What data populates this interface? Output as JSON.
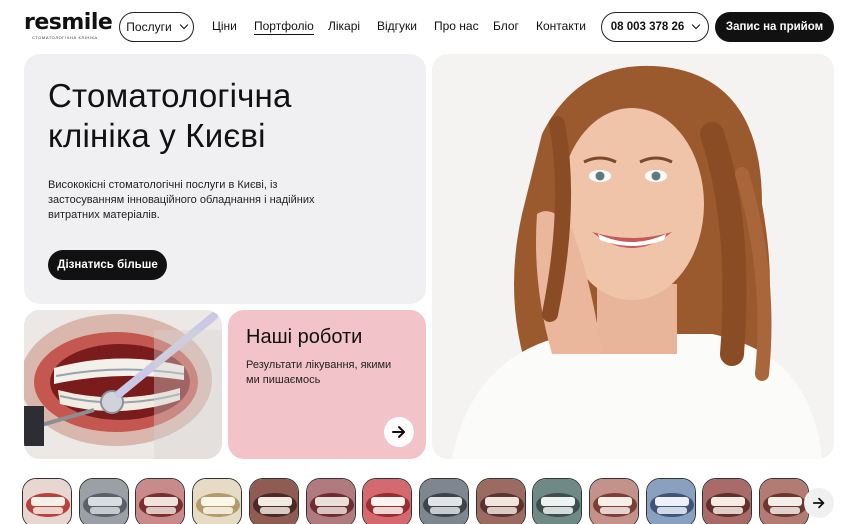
{
  "brand": {
    "logo_text": "resmile",
    "logo_sub": "стоматологічна клініка"
  },
  "nav": {
    "services_label": "Послуги",
    "links": [
      "Ціни",
      "Портфоліо",
      "Лікарі",
      "Відгуки",
      "Про нас",
      "Блог",
      "Контакти"
    ],
    "active_link": "Портфоліо",
    "phone": "08 003 378 26",
    "cta_label": "Запис на прийом"
  },
  "hero": {
    "title_line1": "Стоматологічна",
    "title_line2": "клініка у Києві",
    "description": "Висококісні стоматологічні послуги в Києві, із застосуванням інноваційного обладнання і надійних витратних матеріалів.",
    "button_label": "Дізнатись більше"
  },
  "works": {
    "title": "Наші роботи",
    "description": "Результати лікування, якими ми пишаємось"
  },
  "thumbnails": {
    "count": 14
  },
  "colors": {
    "dark": "#111111",
    "hero_bg": "#f0f0f2",
    "works_bg": "#f2c4c9"
  },
  "icons": {
    "arrow": "arrow-right-icon",
    "dropdown": "chevron-down-icon"
  }
}
